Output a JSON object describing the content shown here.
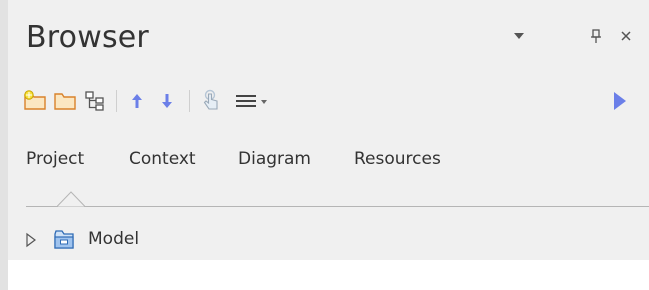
{
  "window": {
    "title": "Browser",
    "controls": {
      "dropdown_icon": "chevron-down-icon",
      "pin_icon": "pin-icon",
      "close_icon": "close-icon"
    }
  },
  "toolbar": {
    "buttons": [
      {
        "icon": "new-package-icon"
      },
      {
        "icon": "folder-icon"
      },
      {
        "icon": "hierarchy-icon"
      },
      {
        "icon": "move-up-icon"
      },
      {
        "icon": "move-down-icon"
      },
      {
        "icon": "touch-hand-icon"
      },
      {
        "icon": "menu-icon"
      },
      {
        "icon": "play-icon"
      }
    ]
  },
  "tabs": [
    {
      "label": "Project",
      "selected": true
    },
    {
      "label": "Context"
    },
    {
      "label": "Diagram"
    },
    {
      "label": "Resources"
    }
  ],
  "tree": {
    "items": [
      {
        "label": "Model",
        "icon": "model-package-icon",
        "expanded": false
      }
    ]
  },
  "colors": {
    "panel_bg": "#f0f0f0",
    "text": "#333333",
    "accent_blue": "#6b7fe8",
    "folder_orange": "#e07a1e"
  }
}
